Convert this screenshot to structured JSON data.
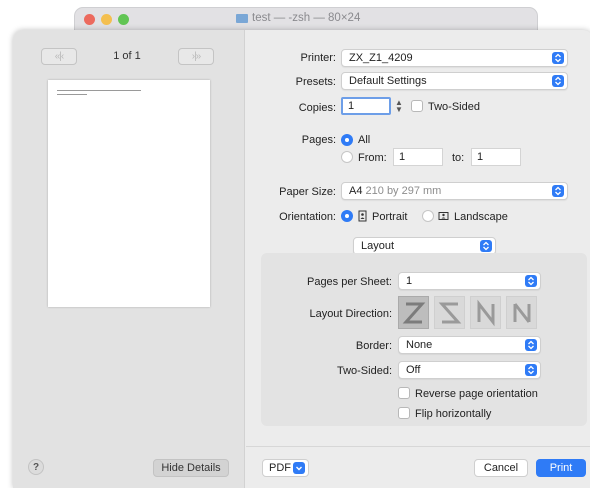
{
  "terminal": {
    "title": "test — -zsh — 80×24",
    "colors": {
      "red": "#ec6a5e",
      "yellow": "#f4bf4f",
      "green": "#61c554"
    }
  },
  "preview": {
    "page_count": "1 of 1",
    "prev_glyph": "«|‹",
    "next_glyph": "›|»"
  },
  "left_footer": {
    "help_label": "?",
    "hide_details_label": "Hide Details"
  },
  "form": {
    "printer": {
      "label": "Printer:",
      "value": "ZX_Z1_4209"
    },
    "presets": {
      "label": "Presets:",
      "value": "Default Settings"
    },
    "copies": {
      "label": "Copies:",
      "value": "1",
      "two_sided_label": "Two-Sided",
      "two_sided_checked": false
    },
    "pages": {
      "label": "Pages:",
      "all_label": "All",
      "from_label": "From:",
      "from_value": "1",
      "to_label": "to:",
      "to_value": "1"
    },
    "paper_size": {
      "label": "Paper Size:",
      "value": "A4",
      "detail": "210 by 297 mm"
    },
    "orientation": {
      "label": "Orientation:",
      "portrait_label": "Portrait",
      "landscape_label": "Landscape",
      "selected": "Portrait"
    },
    "section_popup": "Layout"
  },
  "layout": {
    "pages_per_sheet": {
      "label": "Pages per Sheet:",
      "value": "1"
    },
    "layout_direction": {
      "label": "Layout Direction:",
      "options": [
        "Z",
        "reverse-Z",
        "reverse-N",
        "N"
      ],
      "selected": "Z"
    },
    "border": {
      "label": "Border:",
      "value": "None"
    },
    "two_sided": {
      "label": "Two-Sided:",
      "value": "Off"
    },
    "reverse_orientation": {
      "label": "Reverse page orientation",
      "checked": false
    },
    "flip_horizontally": {
      "label": "Flip horizontally",
      "checked": false
    }
  },
  "footer": {
    "pdf_label": "PDF",
    "cancel_label": "Cancel",
    "print_label": "Print"
  },
  "accent_color": "#2f7bf6"
}
